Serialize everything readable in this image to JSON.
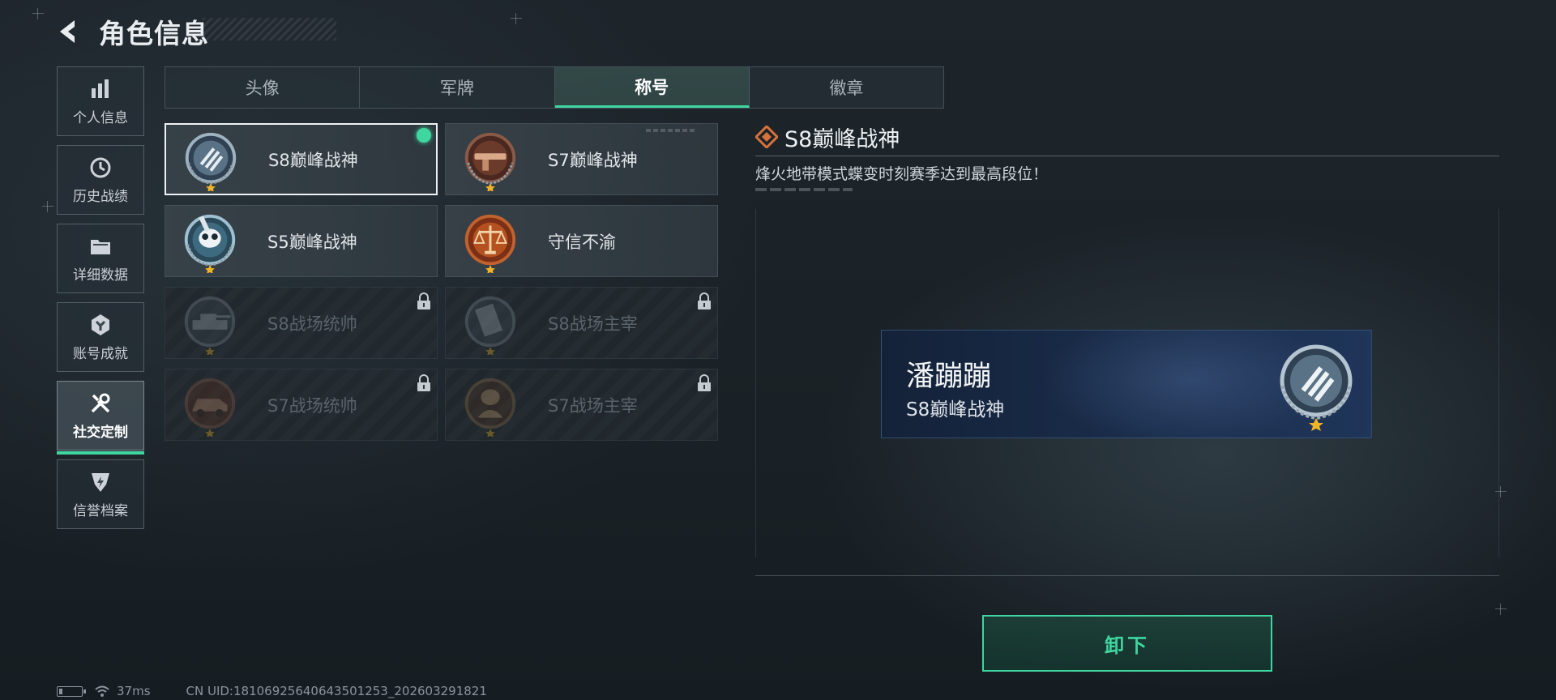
{
  "header": {
    "title": "角色信息"
  },
  "sidebar": {
    "items": [
      {
        "label": "个人信息",
        "icon": "bar-chart-icon",
        "active": false
      },
      {
        "label": "历史战绩",
        "icon": "clock-icon",
        "active": false
      },
      {
        "label": "详细数据",
        "icon": "folder-icon",
        "active": false
      },
      {
        "label": "账号成就",
        "icon": "achievement-icon",
        "active": false
      },
      {
        "label": "社交定制",
        "icon": "tools-icon",
        "active": true
      },
      {
        "label": "信誉档案",
        "icon": "shield-icon",
        "active": false
      }
    ]
  },
  "tabs": [
    {
      "label": "头像",
      "active": false
    },
    {
      "label": "军牌",
      "active": false
    },
    {
      "label": "称号",
      "active": true
    },
    {
      "label": "徽章",
      "active": false
    }
  ],
  "titles": [
    {
      "label": "S8巅峰战神",
      "emblem": "s8-peak-emblem",
      "state": "selected"
    },
    {
      "label": "S7巅峰战神",
      "emblem": "s7-peak-emblem",
      "state": "owned"
    },
    {
      "label": "S5巅峰战神",
      "emblem": "s5-peak-emblem",
      "state": "owned"
    },
    {
      "label": "守信不渝",
      "emblem": "scales-emblem",
      "state": "owned"
    },
    {
      "label": "S8战场统帅",
      "emblem": "tank-emblem",
      "state": "locked"
    },
    {
      "label": "S8战场主宰",
      "emblem": "building-emblem",
      "state": "locked"
    },
    {
      "label": "S7战场统帅",
      "emblem": "vehicle-emblem",
      "state": "locked"
    },
    {
      "label": "S7战场主宰",
      "emblem": "soldier-emblem",
      "state": "locked"
    }
  ],
  "detail": {
    "title": "S8巅峰战神",
    "description": "烽火地带模式蝶变时刻赛季达到最高段位！"
  },
  "nameplate": {
    "player_name": "潘蹦蹦",
    "title": "S8巅峰战神"
  },
  "actions": {
    "unequip_label": "卸下"
  },
  "status_bar": {
    "ping": "37ms",
    "uid": "CN UID:18106925640643501253_202603291821"
  },
  "colors": {
    "accent": "#3fd6a0",
    "nameplate": "#1a2d4b",
    "emblem_orange": "#d9723a"
  }
}
